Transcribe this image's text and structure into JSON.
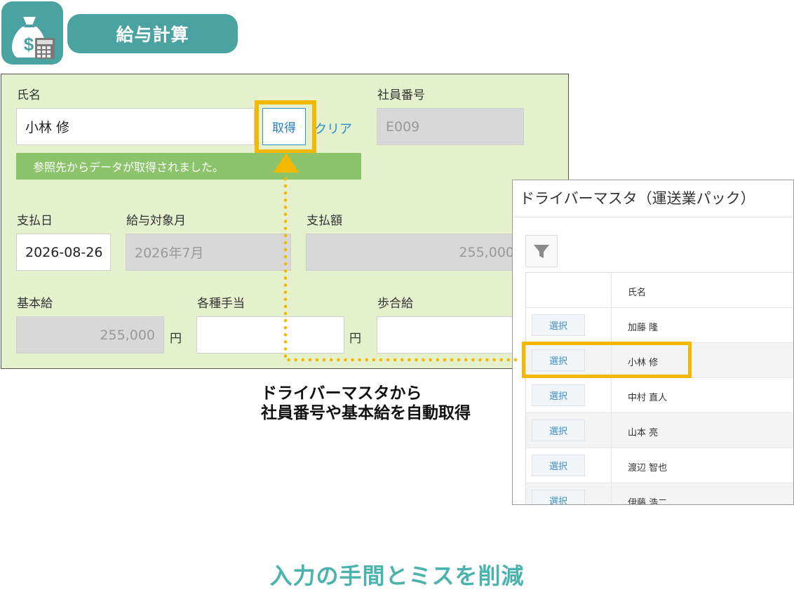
{
  "header": {
    "icon": "money-bag-calculator-icon",
    "app_title": "給与計算"
  },
  "form": {
    "name_label": "氏名",
    "name_value": "小林 修",
    "get_button": "取得",
    "clear_link": "クリア",
    "employee_no_label": "社員番号",
    "employee_no_value": "E009",
    "success_message": "参照先からデータが取得されました。",
    "pay_date_label": "支払日",
    "pay_date_value": "2026-08-26",
    "pay_month_label": "給与対象月",
    "pay_month_value": "2026年7月",
    "pay_amount_label": "支払額",
    "pay_amount_value": "255,000",
    "base_salary_label": "基本給",
    "base_salary_value": "255,000",
    "base_salary_unit": "円",
    "allowance_label": "各種手当",
    "allowance_value": "",
    "allowance_unit": "円",
    "commission_label": "歩合給",
    "commission_value": ""
  },
  "modal": {
    "title": "ドライバーマスタ（運送業パック）",
    "filter_icon": "filter-funnel-icon",
    "column_name": "氏名",
    "select_label": "選択",
    "rows": [
      {
        "name": "加藤 隆"
      },
      {
        "name": "小林 修"
      },
      {
        "name": "中村 直人"
      },
      {
        "name": "山本 亮"
      },
      {
        "name": "渡辺 智也"
      },
      {
        "name": "伊藤 浩二"
      }
    ]
  },
  "callout": {
    "line1": "ドライバーマスタから",
    "line2": "社員番号や基本給を自動取得"
  },
  "tagline": "入力の手間とミスを削減",
  "colors": {
    "teal": "#4aa3a0",
    "form_bg": "#e5f0cd",
    "success_green": "#8cc46b",
    "highlight_yellow": "#f5b800",
    "link_blue": "#2a8fd0"
  }
}
